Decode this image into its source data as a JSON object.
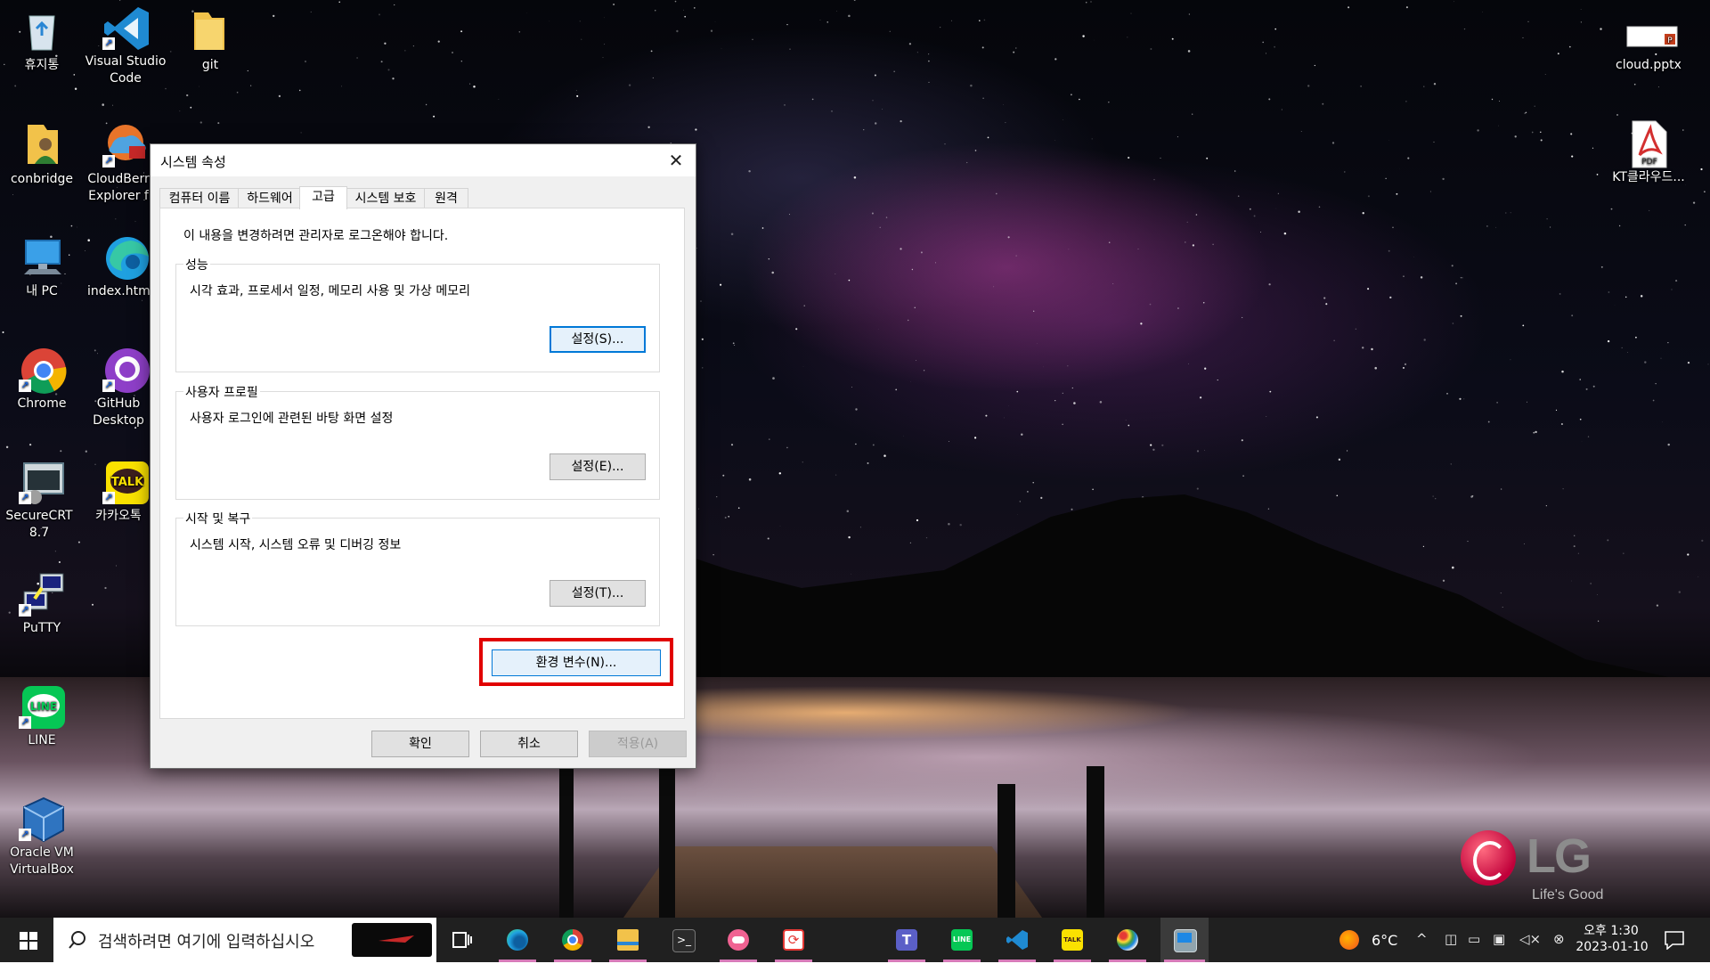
{
  "desktop": {
    "icons": [
      {
        "label": "휴지통"
      },
      {
        "label": "Visual Studio Code"
      },
      {
        "label": "git"
      },
      {
        "label": "conbridge"
      },
      {
        "label": "CloudBerr Explorer f"
      },
      {
        "label": "내 PC"
      },
      {
        "label": "index.htm"
      },
      {
        "label": "Chrome"
      },
      {
        "label": "GitHub Desktop"
      },
      {
        "label": "SecureCRT 8.7"
      },
      {
        "label": "카카오톡"
      },
      {
        "label": "PuTTY"
      },
      {
        "label": "LINE"
      },
      {
        "label": "Oracle VM VirtualBox"
      },
      {
        "label": "cloud.pptx"
      },
      {
        "label": "KT클라우드..."
      }
    ],
    "brand": {
      "name": "LG",
      "slogan": "Life's Good"
    }
  },
  "dialog": {
    "title": "시스템 속성",
    "close_glyph": "✕",
    "tabs": [
      "컴퓨터 이름",
      "하드웨어",
      "고급",
      "시스템 보호",
      "원격"
    ],
    "active_tab": "고급",
    "admin_note": "이 내용을 변경하려면 관리자로 로그온해야 합니다.",
    "groups": [
      {
        "label": "성능",
        "description": "시각 효과, 프로세서 일정, 메모리 사용 및 가상 메모리",
        "button": "설정(S)..."
      },
      {
        "label": "사용자 프로필",
        "description": "사용자 로그인에 관련된 바탕 화면 설정",
        "button": "설정(E)..."
      },
      {
        "label": "시작 및 복구",
        "description": "시스템 시작, 시스템 오류 및 디버깅 정보",
        "button": "설정(T)..."
      }
    ],
    "env_button": "환경 변수(N)...",
    "footer": {
      "ok": "확인",
      "cancel": "취소",
      "apply": "적용(A)"
    }
  },
  "taskbar": {
    "search_placeholder": "검색하려면 여기에 입력하십시오",
    "pinned": [
      "task-view",
      "edge",
      "chrome",
      "file-explorer",
      "terminal",
      "app-pink",
      "app-refresh",
      "teams",
      "line",
      "vscode",
      "kakaotalk",
      "paint",
      "system-properties"
    ],
    "weather": {
      "temp": "6°C"
    },
    "clock": {
      "time": "오후 1:30",
      "date": "2023-01-10"
    }
  },
  "colors": {
    "highlight": "#e10000",
    "focus": "#0078d7",
    "taskbar": "#202020"
  }
}
